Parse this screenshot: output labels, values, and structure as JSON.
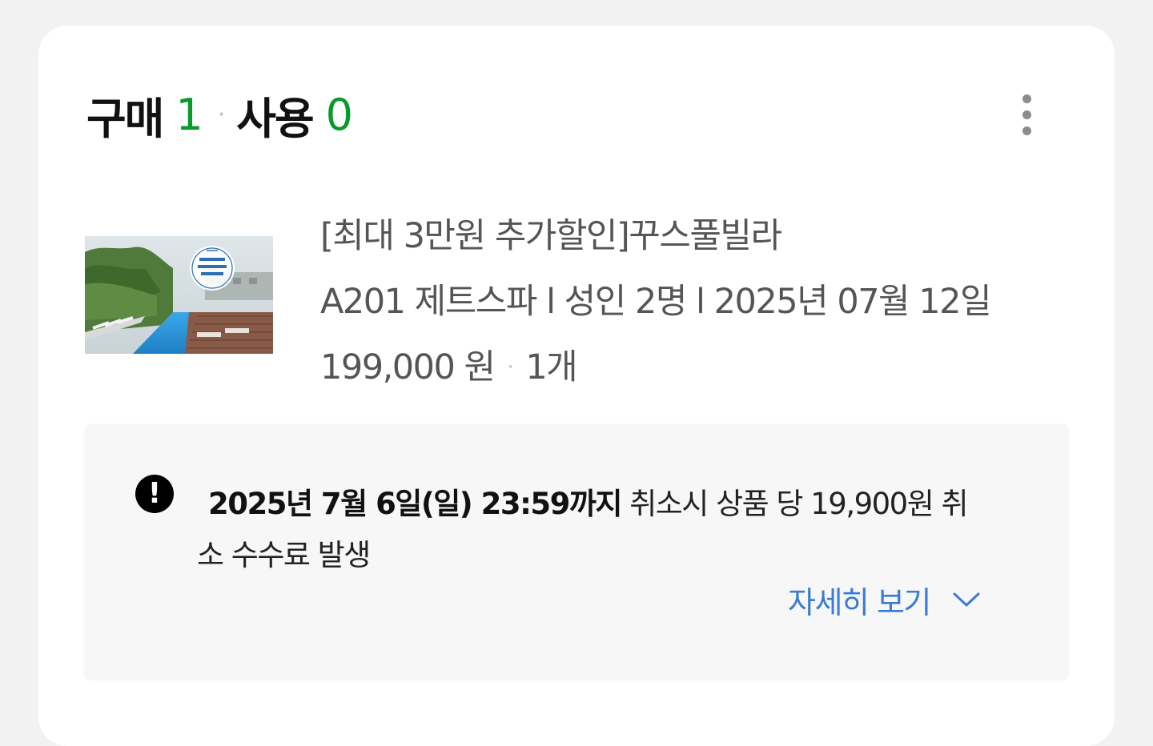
{
  "summary": {
    "purchase_label": "구매",
    "purchase_count": "1",
    "separator": "·",
    "use_label": "사용",
    "use_count": "0"
  },
  "more_menu_icon": "vertical-dots-icon",
  "product": {
    "title": "[최대 3만원 추가할인]꾸스풀빌라",
    "option": "A201 제트스파 l 성인 2명 l 2025년 07월 12일",
    "price": "199,000 원",
    "separator": "·",
    "quantity": "1개"
  },
  "notice": {
    "icon": "exclamation-circle-icon",
    "deadline": "2025년 7월 6일(일) 23:59까지",
    "message_part1": " 취소시 상품 당 19,900원 취",
    "message_part2": "소 수수료 발생",
    "detail_label": "자세히 보기",
    "detail_icon": "chevron-down-icon"
  },
  "colors": {
    "count_green": "#0a9a2a",
    "link_blue": "#3a7bd5",
    "card_bg": "#ffffff",
    "page_bg": "#f2f2f2",
    "notice_bg": "#f7f7f7"
  }
}
